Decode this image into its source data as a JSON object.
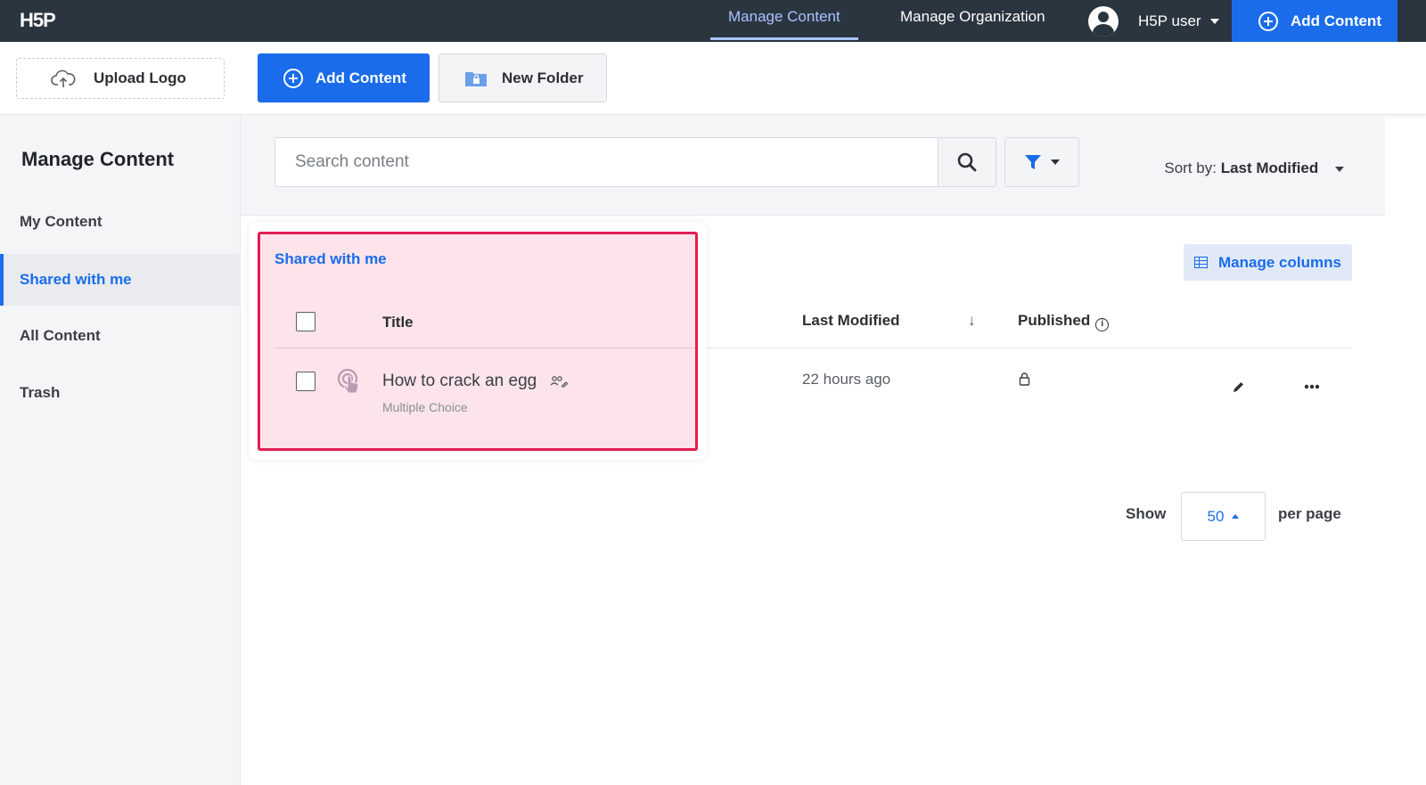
{
  "topbar": {
    "logo": "H5P",
    "nav": [
      "Manage Content",
      "Manage Organization"
    ],
    "active_nav": "Manage Content",
    "user": "H5P user",
    "add_content": "Add Content"
  },
  "toolbar": {
    "upload_logo": "Upload Logo",
    "add_content": "Add Content",
    "new_folder": "New Folder"
  },
  "sidebar": {
    "title": "Manage Content",
    "items": [
      "My Content",
      "Shared with me",
      "All Content",
      "Trash"
    ],
    "active": "Shared with me"
  },
  "search": {
    "placeholder": "Search content",
    "sort_prefix": "Sort by:",
    "sort_value": "Last Modified"
  },
  "table": {
    "manage_columns": "Manage columns",
    "columns": [
      "Title",
      "Last Modified",
      "Published"
    ],
    "rows": [
      {
        "title": "How to crack an egg",
        "type": "Multiple Choice",
        "last_modified": "22 hours ago"
      }
    ]
  },
  "popup": {
    "heading": "Shared with me"
  },
  "pagination": {
    "show": "Show",
    "per_page_value": "50",
    "per_page": "per page"
  },
  "colors": {
    "topbar": "#2b3540",
    "primary": "#1a6cea",
    "highlight_border": "#e11d52",
    "highlight_fill": "#fce4ea"
  }
}
